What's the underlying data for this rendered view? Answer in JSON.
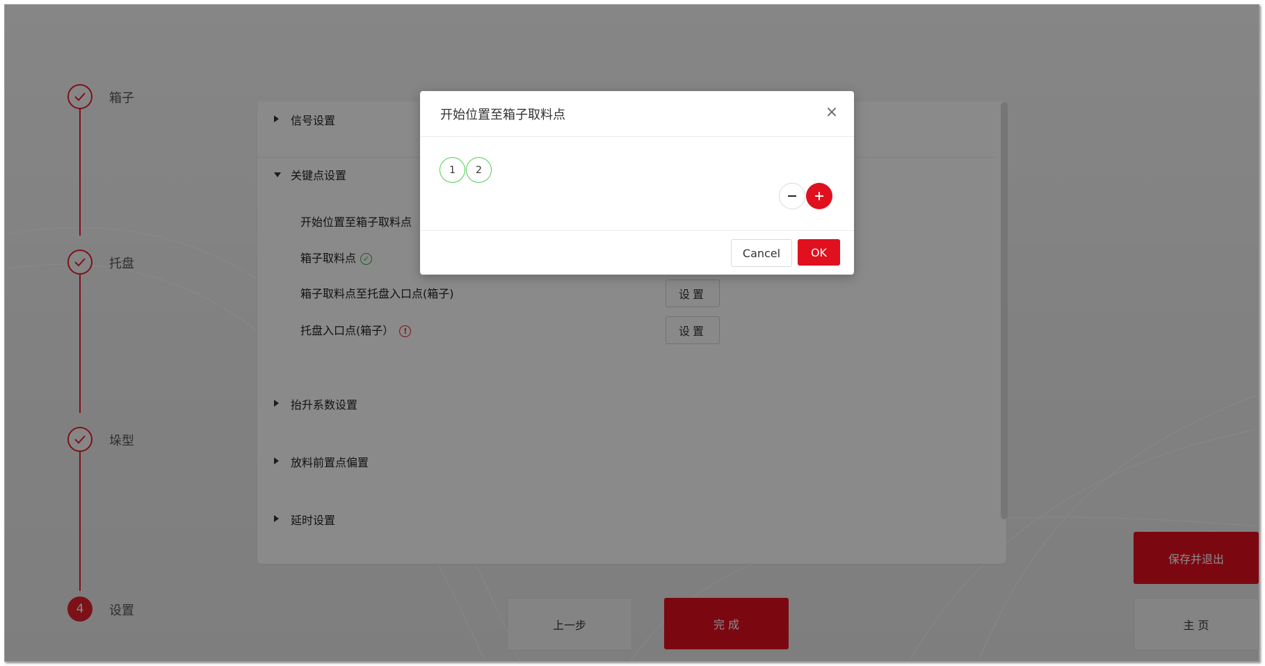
{
  "stepper": [
    {
      "label": "箱子",
      "status": "done"
    },
    {
      "label": "托盘",
      "status": "done"
    },
    {
      "label": "垛型",
      "status": "done"
    },
    {
      "label": "设置",
      "status": "active",
      "number": "4"
    }
  ],
  "panel": {
    "signal": "信号设置",
    "keypoints": {
      "title": "关键点设置",
      "rows": [
        {
          "label": "开始位置至箱子取料点"
        },
        {
          "label": "箱子取料点",
          "status": "ok"
        },
        {
          "label": "箱子取料点至托盘入口点(箱子)",
          "button": "设置"
        },
        {
          "label": "托盘入口点(箱子）",
          "status": "warning",
          "button": "设置"
        }
      ]
    },
    "lift": "抬升系数设置",
    "place_offset": "放料前置点偏置",
    "delay": "延时设置"
  },
  "footer": {
    "prev": "上一步",
    "finish": "完 成",
    "save_exit": "保存并退出",
    "home": "主 页"
  },
  "modal": {
    "title": "开始位置至箱子取料点",
    "points": [
      "1",
      "2"
    ],
    "cancel": "Cancel",
    "ok": "OK"
  },
  "colors": {
    "accent": "#e0101f",
    "point_border": "#4ccd55"
  }
}
